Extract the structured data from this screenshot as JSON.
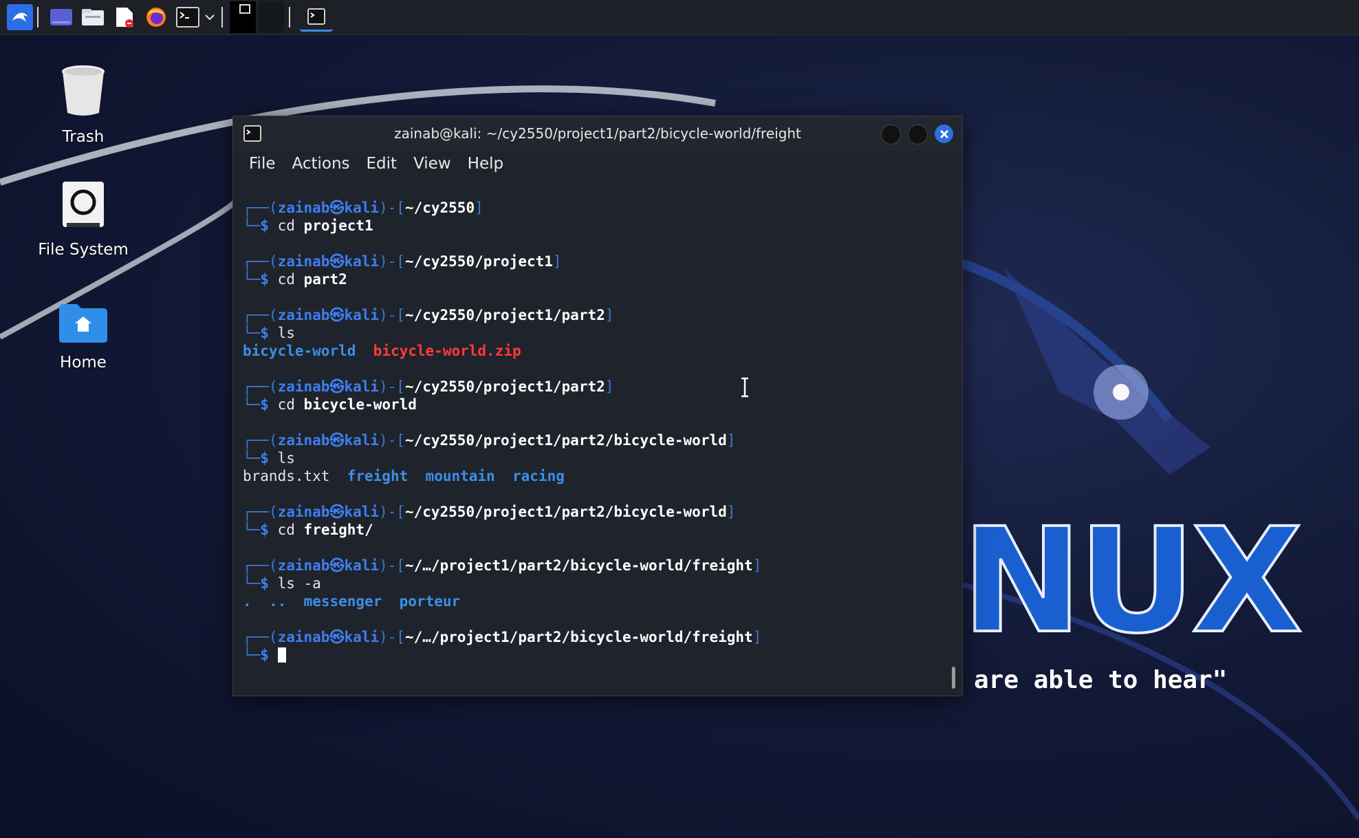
{
  "desktop": {
    "icons": [
      {
        "label": "Trash"
      },
      {
        "label": "File System"
      },
      {
        "label": "Home"
      }
    ],
    "wallpaper_text": "NUX",
    "wallpaper_tagline": "are able to hear\""
  },
  "taskbar": {
    "apps": [
      "kali-menu-icon",
      "workspace-icon",
      "file-manager-icon",
      "text-editor-icon",
      "firefox-icon",
      "terminal-icon",
      "chevron-down-icon"
    ]
  },
  "terminal": {
    "title": "zainab@kali: ~/cy2550/project1/part2/bicycle-world/freight",
    "menu": [
      "File",
      "Actions",
      "Edit",
      "View",
      "Help"
    ],
    "prompt_user": "zainab",
    "prompt_host": "kali",
    "blocks": [
      {
        "path": "~/cy2550",
        "cmd": "cd",
        "arg": "project1"
      },
      {
        "path": "~/cy2550/project1",
        "cmd": "cd",
        "arg": "part2"
      },
      {
        "path": "~/cy2550/project1/part2",
        "cmd": "ls",
        "arg": ""
      },
      {
        "path": "~/cy2550/project1/part2",
        "cmd": "cd",
        "arg": "bicycle-world"
      },
      {
        "path": "~/cy2550/project1/part2/bicycle-world",
        "cmd": "ls",
        "arg": ""
      },
      {
        "path": "~/cy2550/project1/part2/bicycle-world",
        "cmd": "cd",
        "arg": "freight/"
      },
      {
        "path": "~/…/project1/part2/bicycle-world/freight",
        "cmd": "ls -a",
        "arg": ""
      },
      {
        "path": "~/…/project1/part2/bicycle-world/freight",
        "cmd": "",
        "arg": ""
      }
    ],
    "outputs": {
      "ls_part2": [
        "bicycle-world",
        "bicycle-world.zip"
      ],
      "ls_bicycle_world": [
        "brands.txt",
        "freight",
        "mountain",
        "racing"
      ],
      "ls_freight": [
        ".",
        "..",
        "messenger",
        "porteur"
      ]
    }
  },
  "colors": {
    "accent": "#3d8ee9",
    "prompt_frame": "#3a7bd5",
    "archive": "#ff3b3b",
    "close_button": "#2f6fe0"
  }
}
